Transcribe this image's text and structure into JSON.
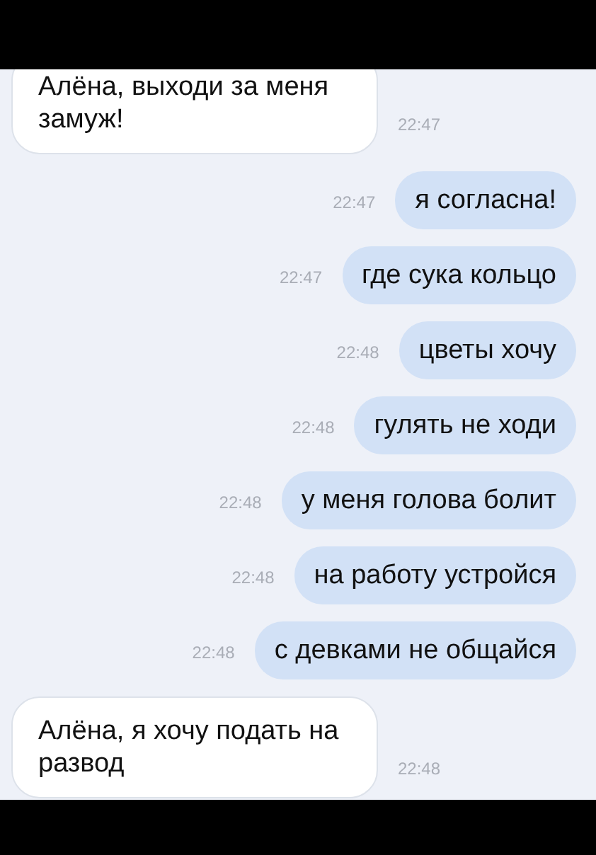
{
  "messages": [
    {
      "kind": "incoming",
      "text": "Алёна, выходи за меня замуж!",
      "time": "22:47"
    },
    {
      "kind": "outgoing",
      "text": "я согласна!",
      "time": "22:47"
    },
    {
      "kind": "outgoing",
      "text": "где сука кольцо",
      "time": "22:47"
    },
    {
      "kind": "outgoing",
      "text": "цветы хочу",
      "time": "22:48"
    },
    {
      "kind": "outgoing",
      "text": "гулять не ходи",
      "time": "22:48"
    },
    {
      "kind": "outgoing",
      "text": "у меня голова болит",
      "time": "22:48"
    },
    {
      "kind": "outgoing",
      "text": "на работу устройся",
      "time": "22:48"
    },
    {
      "kind": "outgoing",
      "text": "с девками не общайся",
      "time": "22:48"
    },
    {
      "kind": "incoming",
      "text": "Алёна, я хочу подать на развод",
      "time": "22:48"
    }
  ]
}
